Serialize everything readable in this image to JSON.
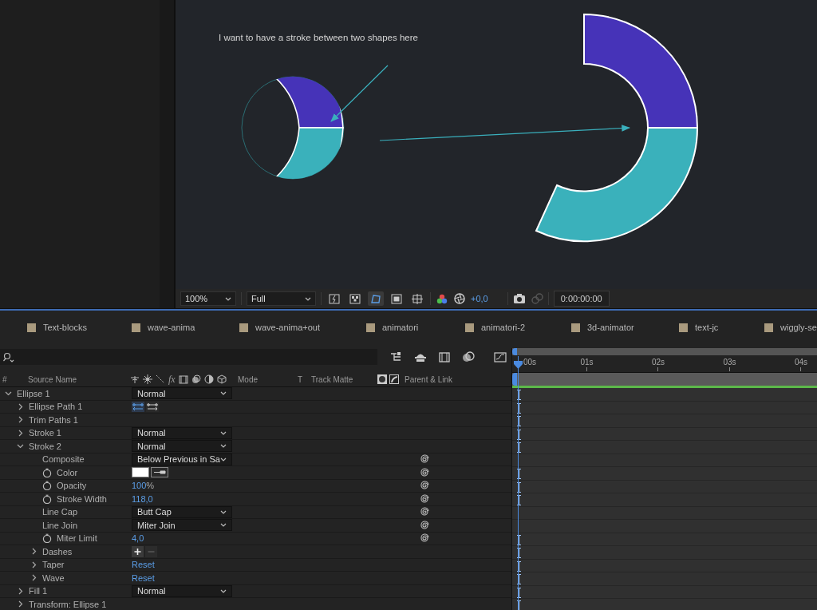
{
  "viewer": {
    "annotation": "I want to have a stroke between two shapes here",
    "toolbar": {
      "zoom": "100%",
      "resolution": "Full",
      "exposure": "+0,0",
      "timecode": "0:00:00:00"
    }
  },
  "tabs": [
    {
      "label": "Text-blocks"
    },
    {
      "label": "wave-anima"
    },
    {
      "label": "wave-anima+out"
    },
    {
      "label": "animatori"
    },
    {
      "label": "animatori-2"
    },
    {
      "label": "3d-animator"
    },
    {
      "label": "text-jc"
    },
    {
      "label": "wiggly-se"
    }
  ],
  "timeline": {
    "columns": {
      "number": "#",
      "source_name": "Source Name",
      "fx": "fx",
      "mode": "Mode",
      "t": "T",
      "track_matte": "Track Matte",
      "parent": "Parent & Link"
    },
    "ruler": [
      "00s",
      "01s",
      "02s",
      "03s",
      "04s"
    ],
    "layers": [
      {
        "name": "Ellipse 1",
        "expanded": true,
        "kind": "dropdown",
        "value": "Normal",
        "bar": true,
        "children": [
          {
            "name": "Ellipse Path 1",
            "expanded": false,
            "kind": "path-direction",
            "bar": true
          },
          {
            "name": "Trim Paths 1",
            "expanded": false,
            "kind": "none",
            "bar": true
          },
          {
            "name": "Stroke 1",
            "expanded": false,
            "kind": "dropdown",
            "value": "Normal",
            "bar": true
          },
          {
            "name": "Stroke 2",
            "expanded": true,
            "kind": "dropdown",
            "value": "Normal",
            "bar": true,
            "children": [
              {
                "name": "Composite",
                "kind": "dropdown",
                "value": "Below Previous in Sa",
                "bar": false,
                "link": true
              },
              {
                "name": "Color",
                "stopwatch": true,
                "kind": "color",
                "color": "#ffffff",
                "bar": true,
                "link": true
              },
              {
                "name": "Opacity",
                "stopwatch": true,
                "kind": "number",
                "value": "100",
                "unit": "%",
                "bar": true,
                "link": true
              },
              {
                "name": "Stroke Width",
                "stopwatch": true,
                "kind": "number",
                "value": "118,0",
                "bar": true,
                "link": true
              },
              {
                "name": "Line Cap",
                "kind": "dropdown",
                "value": "Butt Cap",
                "bar": false,
                "link": true
              },
              {
                "name": "Line Join",
                "kind": "dropdown",
                "value": "Miter Join",
                "bar": false,
                "link": true
              },
              {
                "name": "Miter Limit",
                "stopwatch": true,
                "kind": "number",
                "value": "4,0",
                "bar": true,
                "link": true
              },
              {
                "name": "Dashes",
                "expanded": false,
                "kind": "add-remove",
                "bar": true
              },
              {
                "name": "Taper",
                "expanded": false,
                "kind": "reset",
                "value": "Reset",
                "bar": true
              },
              {
                "name": "Wave",
                "expanded": false,
                "kind": "reset",
                "value": "Reset",
                "bar": true
              }
            ]
          },
          {
            "name": "Fill 1",
            "expanded": false,
            "kind": "dropdown",
            "value": "Normal",
            "bar": true
          },
          {
            "name": "Transform: Ellipse 1",
            "expanded": false,
            "kind": "none",
            "bar": true
          }
        ]
      }
    ]
  }
}
